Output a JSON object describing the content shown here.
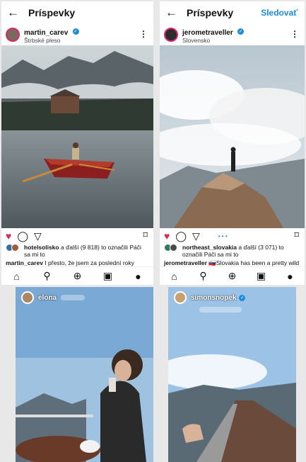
{
  "left": {
    "header": {
      "back_icon": "arrow-left-icon",
      "title": "Príspevky"
    },
    "post": {
      "username": "martin_carev",
      "location": "Štrbské pleso",
      "liked_by_user": "hotelsolisko",
      "liked_by_rest": "a ďalší (9 818) to označili Páči sa mi to",
      "caption_user": "martin_carev",
      "caption_text": "I přesto, že jsem za poslední roky procestoval skoro celý svět, tak jsem zatím neměl šanci poznat zemi našich nejbližších sousedů 🇸🇰 To"
    }
  },
  "right": {
    "header": {
      "back_icon": "arrow-left-icon",
      "title": "Príspevky",
      "follow_label": "Sledovať"
    },
    "post": {
      "username": "jerometraveller",
      "location": "Slovensko",
      "liked_by_user": "northeast_slovakia",
      "liked_by_rest": "a ďalší (3 071) to označili Páči sa mi to",
      "caption_user": "jerometraveller",
      "caption_text": "🇸🇰Slovakia has been a pretty wild adventure ☁️⛰️🔥 This peak is called Lomnický štít,"
    }
  },
  "stories": {
    "left_user": "elona",
    "right_user": "simonsnopek"
  },
  "colors": {
    "like": "#e0245e",
    "accent": "#1a8cd8",
    "story_ring": "#d62976"
  }
}
